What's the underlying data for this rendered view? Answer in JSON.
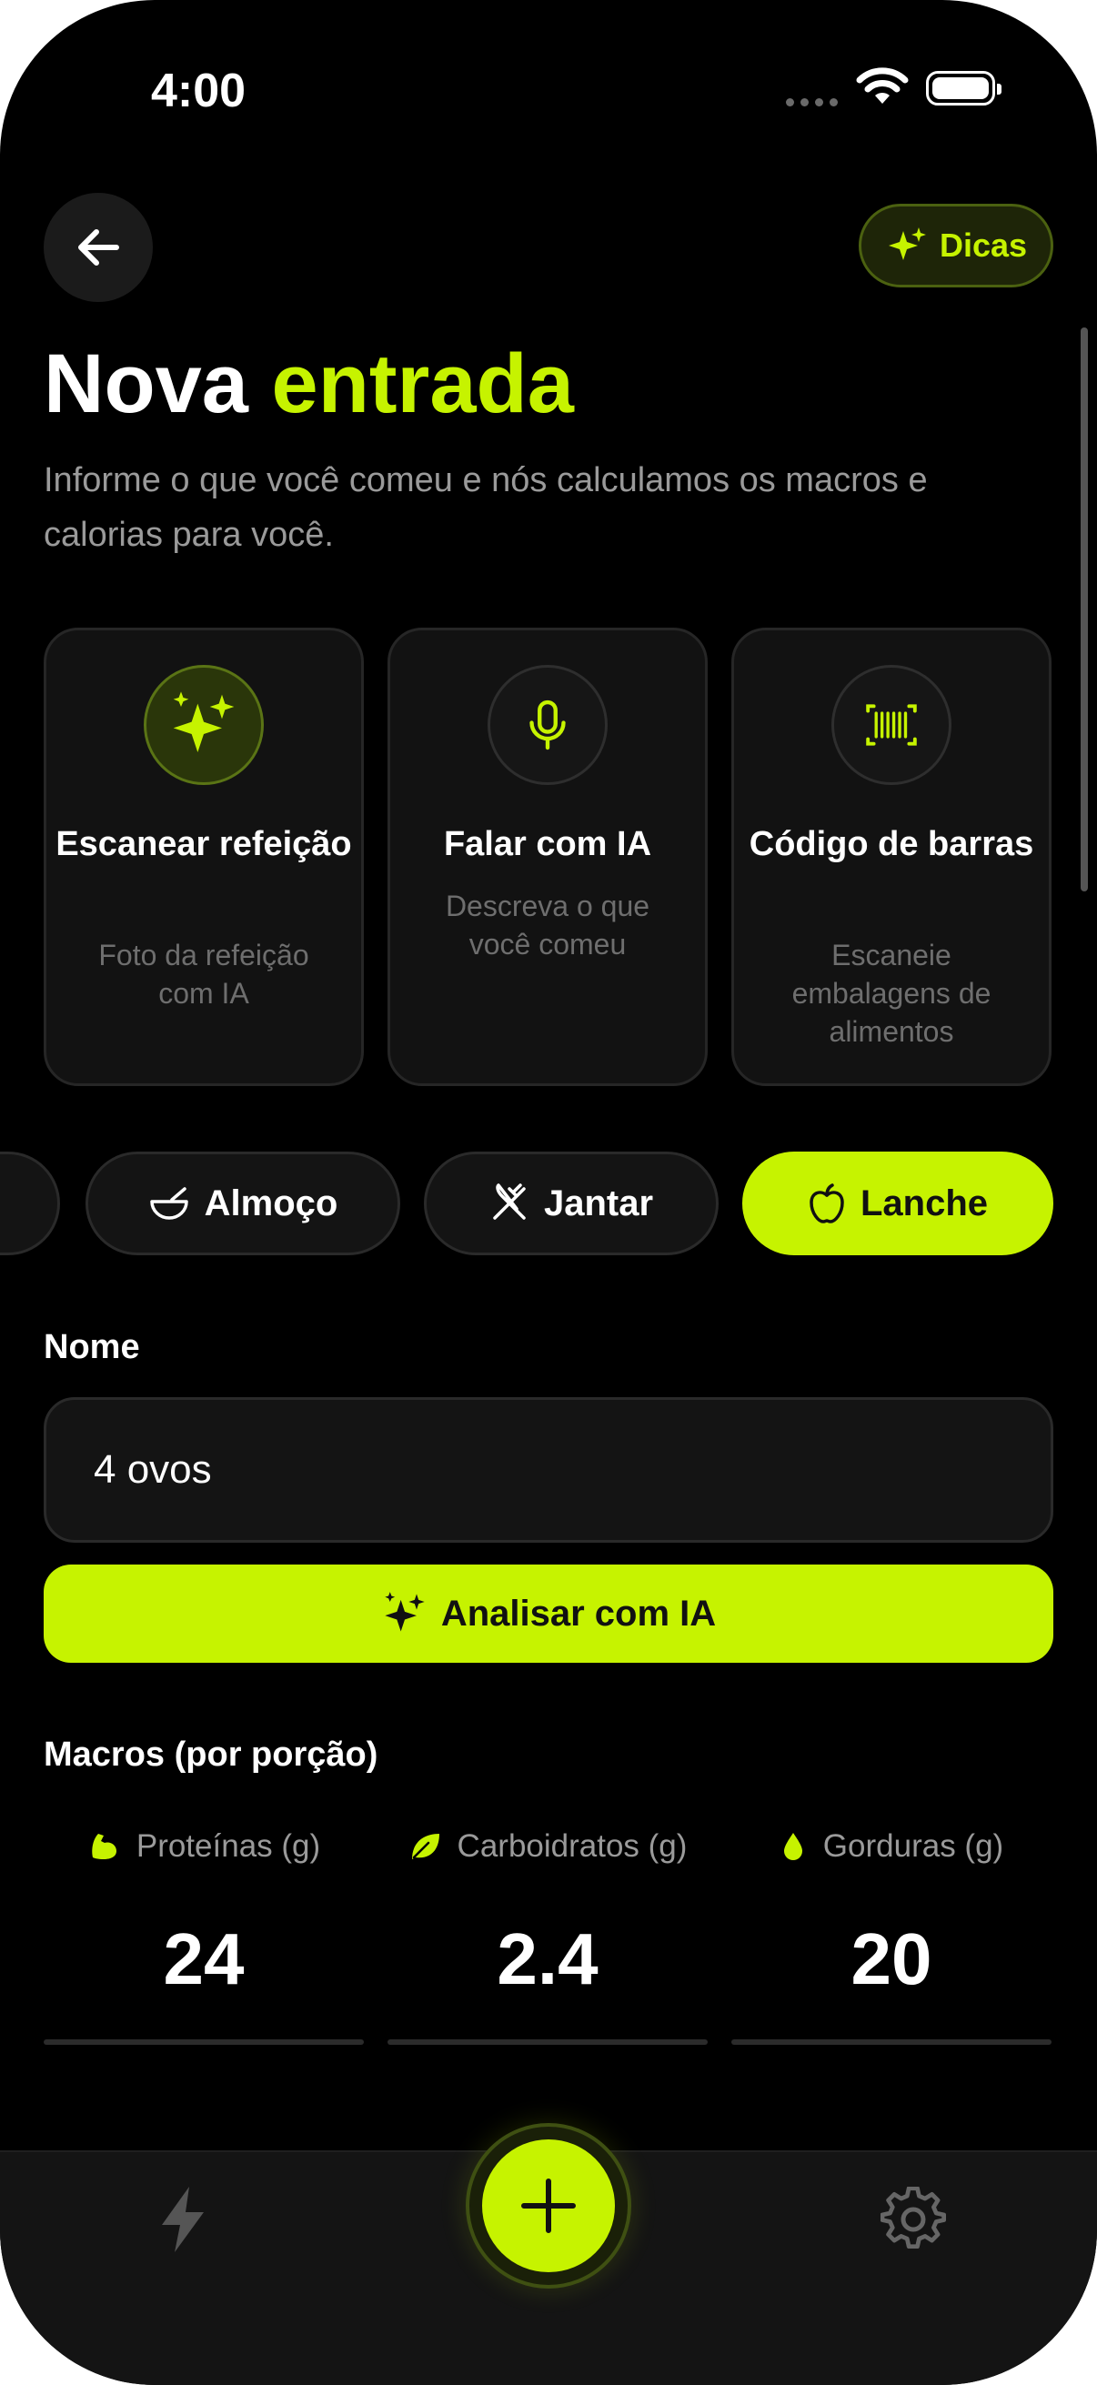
{
  "status_bar": {
    "time": "4:00"
  },
  "header": {
    "tips_label": "Dicas"
  },
  "page": {
    "title_main": "Nova",
    "title_accent": "entrada",
    "subtitle": "Informe o que você comeu e nós calculamos os macros e calorias para você."
  },
  "methods": [
    {
      "title": "Escanear refeição",
      "desc": "Foto da refeição com IA"
    },
    {
      "title": "Falar com IA",
      "desc": "Descreva o que você comeu"
    },
    {
      "title": "Código de barras",
      "desc": "Escaneie embalagens de alimentos"
    }
  ],
  "meal_types": [
    {
      "label": "Almoço",
      "active": false
    },
    {
      "label": "Jantar",
      "active": false
    },
    {
      "label": "Lanche",
      "active": true
    }
  ],
  "form": {
    "name_label": "Nome",
    "name_value": "4 ovos",
    "analyze_label": "Analisar com IA"
  },
  "macros": {
    "label": "Macros (por porção)",
    "items": [
      {
        "name": "Proteínas (g)",
        "value": "24"
      },
      {
        "name": "Carboidratos (g)",
        "value": "2.4"
      },
      {
        "name": "Gorduras (g)",
        "value": "20"
      }
    ]
  },
  "colors": {
    "accent": "#c6f300",
    "background": "#000000",
    "surface": "#141414"
  },
  "icons": {
    "back": "arrow-left-icon",
    "tips": "sparkles-icon",
    "methods": [
      "sparkles-icon",
      "microphone-icon",
      "barcode-icon"
    ],
    "meal_types": [
      "bowl-icon",
      "fork-knife-icon",
      "apple-icon"
    ],
    "macros": [
      "bicep-icon",
      "leaf-icon",
      "drop-icon"
    ],
    "tabbar": [
      "bolt-icon",
      "plus-icon",
      "gear-icon"
    ]
  }
}
